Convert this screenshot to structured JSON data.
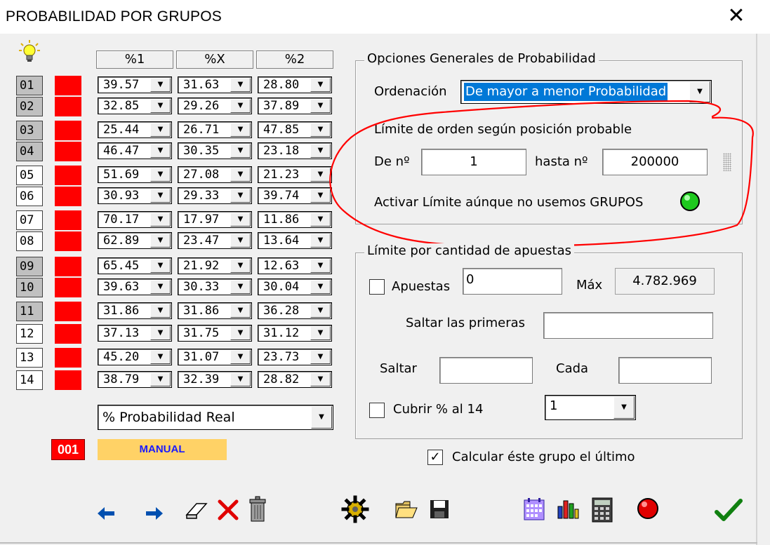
{
  "window": {
    "title": "PROBABILIDAD POR GRUPOS",
    "close_glyph": "✕"
  },
  "table": {
    "headers": [
      "%1",
      "%X",
      "%2"
    ],
    "rows": [
      {
        "label": "01",
        "shade": "gray",
        "v": [
          "39.57",
          "31.63",
          "28.80"
        ]
      },
      {
        "label": "02",
        "shade": "gray",
        "v": [
          "32.85",
          "29.26",
          "37.89"
        ]
      },
      {
        "label": "03",
        "shade": "gray",
        "v": [
          "25.44",
          "26.71",
          "47.85"
        ]
      },
      {
        "label": "04",
        "shade": "gray",
        "v": [
          "46.47",
          "30.35",
          "23.18"
        ]
      },
      {
        "label": "05",
        "shade": "white",
        "v": [
          "51.69",
          "27.08",
          "21.23"
        ]
      },
      {
        "label": "06",
        "shade": "white",
        "v": [
          "30.93",
          "29.33",
          "39.74"
        ]
      },
      {
        "label": "07",
        "shade": "white",
        "v": [
          "70.17",
          "17.97",
          "11.86"
        ]
      },
      {
        "label": "08",
        "shade": "white",
        "v": [
          "62.89",
          "23.47",
          "13.64"
        ]
      },
      {
        "label": "09",
        "shade": "gray",
        "v": [
          "65.45",
          "21.92",
          "12.63"
        ]
      },
      {
        "label": "10",
        "shade": "gray",
        "v": [
          "39.63",
          "30.33",
          "30.04"
        ]
      },
      {
        "label": "11",
        "shade": "gray",
        "v": [
          "31.86",
          "31.86",
          "36.28"
        ]
      },
      {
        "label": "12",
        "shade": "white",
        "v": [
          "37.13",
          "31.75",
          "31.12"
        ]
      },
      {
        "label": "13",
        "shade": "white",
        "v": [
          "45.20",
          "31.07",
          "23.73"
        ]
      },
      {
        "label": "14",
        "shade": "white",
        "v": [
          "38.79",
          "32.39",
          "28.82"
        ]
      }
    ],
    "prob_select": "% Probabilidad Real",
    "counter": "001",
    "manual": "MANUAL"
  },
  "general": {
    "legend": "Opciones Generales de Probabilidad",
    "ordenacion_label": "Ordenación",
    "ordenacion_value": "De mayor a menor Probabilidad",
    "limite_label": "Límite de orden según posición probable",
    "de_label": "De nº",
    "de_value": "1",
    "hasta_label": "hasta nº",
    "hasta_value": "200000",
    "activar_label": "Activar Límite aúnque no usemos GRUPOS"
  },
  "cantidad": {
    "legend": "Límite por cantidad de apuestas",
    "apuestas_label": "Apuestas",
    "apuestas_value": "0",
    "max_label": "Máx",
    "max_value": "4.782.969",
    "saltar_primeras_label": "Saltar las primeras",
    "saltar_label": "Saltar",
    "cada_label": "Cada",
    "cubrir_label": "Cubrir % al 14",
    "cubrir_value": "1"
  },
  "calcular_label": "Calcular éste grupo el último",
  "colors": {
    "red": "#ff0000",
    "manual_bg": "#ffd266",
    "manual_text": "#1a1aff",
    "led": "#22cc22",
    "annotation": "#ff0000"
  },
  "icons": [
    "arrow-left-icon",
    "arrow-right-icon",
    "eraser-icon",
    "delete-x-icon",
    "trash-icon",
    "gear-icon",
    "folder-open-icon",
    "save-icon",
    "calendar-icon",
    "bar-chart-icon",
    "calculator-icon",
    "record-icon",
    "checkmark-icon"
  ]
}
